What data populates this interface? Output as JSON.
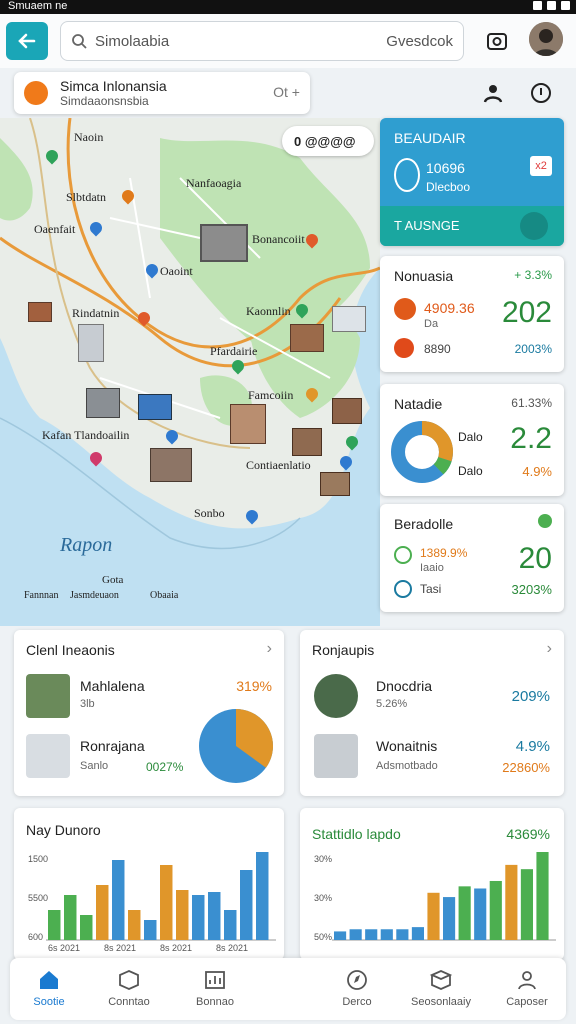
{
  "statusbar": {
    "text": "Smuaem ne"
  },
  "topbar": {
    "search_placeholder": "Simolaabia",
    "search_action": "Gvesdcok"
  },
  "location_card": {
    "title": "Simca Inlonansia",
    "subtitle": "Simdaaonsnsbia",
    "action": "Ot +"
  },
  "map": {
    "labels": [
      "Naoin",
      "Slbtdatn",
      "Nanfaoagia",
      "Oaenfait",
      "Oaoint",
      "Bonancoiit",
      "Kaonnlin",
      "Rindatnin",
      "Pfardairie",
      "Famcoiin",
      "Kafan Tlandoailin",
      "Contiaenlatio",
      "Sonbo",
      "Rapon",
      "Gota",
      "Fannnan",
      "Jasmdeuaon",
      "Obaaia"
    ],
    "compass": "0 @@@@"
  },
  "side_card1": {
    "title": "BEAUDAIR",
    "value1": "10696",
    "value2": "Dlecboo",
    "badge": "x2",
    "footer": "T AUSNGE",
    "colors": {
      "bg": "#2f9ed0",
      "footer": "#1aa7a0"
    }
  },
  "side_card2": {
    "title": "Nonuasia",
    "change": "+ 3.3%",
    "row1_value": "4909.36",
    "row1_sub": "Da",
    "big": "202",
    "row2_value": "8890",
    "row2_pct": "2003%"
  },
  "side_card3": {
    "title": "Natadie",
    "change": "61.33%",
    "label1": "Dalo",
    "big": "2.2",
    "label2": "Dalo",
    "pct": "4.9%"
  },
  "side_card4": {
    "title": "Beradolle",
    "row1": "1389.9%",
    "row1_sub": "Iaaio",
    "big": "20",
    "row2": "Tasi",
    "row2_pct": "3203%"
  },
  "card_left": {
    "title": "Clenl Ineaonis",
    "rows": [
      {
        "name": "Mahlalena",
        "sub": "3lb",
        "pct": "319%"
      },
      {
        "name": "Ronrajana",
        "sub": "Sanlo",
        "pct": "0027%"
      }
    ],
    "pie": [
      35,
      65
    ]
  },
  "card_right": {
    "title": "Ronjaupis",
    "rows": [
      {
        "name": "Dnocdria",
        "sub": "5.26%",
        "pct": "209%"
      },
      {
        "name": "Wonaitnis",
        "sub": "Adsmotbado",
        "pct": "4.9%",
        "pct2": "22860%"
      }
    ]
  },
  "chart_left_card": {
    "title": "Nay Dunoro"
  },
  "chart_right_card": {
    "title": "Stattidlo lapdo",
    "value": "4369%"
  },
  "nav": {
    "items": [
      "Sootie",
      "Conntao",
      "Bonnao",
      "Derco",
      "Seosonlaaiy",
      "Caposer"
    ]
  },
  "chart_data": [
    {
      "type": "bar",
      "title": "Nay Dunoro",
      "y_ticks": [
        "1500",
        "5500",
        "600"
      ],
      "x_ticks": [
        "6s 2021",
        "8s 2021",
        "8s 2021",
        "8s 2021"
      ],
      "series": [
        {
          "values": [
            30,
            45,
            25,
            55,
            80,
            30,
            20,
            75,
            50,
            45,
            48,
            30,
            70,
            88
          ]
        }
      ],
      "colors": [
        "#4caf50",
        "#4caf50",
        "#4caf50",
        "#e0962a",
        "#3a8fd0",
        "#e0962a",
        "#3a8fd0",
        "#e0962a",
        "#e0962a",
        "#3a8fd0",
        "#3a8fd0",
        "#3a8fd0",
        "#3a8fd0",
        "#3a8fd0"
      ]
    },
    {
      "type": "bar",
      "title": "Stattidlo lapdo",
      "y_ticks": [
        "30%",
        "30%",
        "50%"
      ],
      "series": [
        {
          "values": [
            8,
            10,
            10,
            10,
            10,
            12,
            44,
            40,
            50,
            48,
            55,
            70,
            66,
            82
          ]
        }
      ],
      "colors": [
        "#3a8fd0",
        "#3a8fd0",
        "#3a8fd0",
        "#3a8fd0",
        "#3a8fd0",
        "#3a8fd0",
        "#e0962a",
        "#3a8fd0",
        "#4caf50",
        "#3a8fd0",
        "#4caf50",
        "#e0962a",
        "#4caf50",
        "#4caf50"
      ]
    }
  ]
}
